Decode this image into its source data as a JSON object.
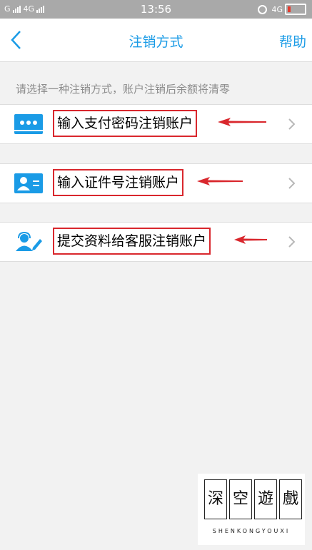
{
  "status_bar": {
    "carrier1": "G",
    "carrier2": "4G",
    "time": "13:56",
    "network_right": "4G"
  },
  "nav": {
    "title": "注销方式",
    "help_label": "帮助"
  },
  "hint": "请选择一种注销方式，账户注销后余额将清零",
  "options": [
    {
      "label": "输入支付密码注销账户",
      "icon": "password-dots-icon"
    },
    {
      "label": "输入证件号注销账户",
      "icon": "id-card-icon"
    },
    {
      "label": "提交资料给客服注销账户",
      "icon": "customer-service-icon"
    }
  ],
  "watermark": {
    "chars": [
      "深",
      "空",
      "遊",
      "戲"
    ],
    "subtitle": "SHENKONGYOUXI"
  },
  "colors": {
    "accent": "#1a9be6",
    "annotation_red": "#d9272d"
  }
}
